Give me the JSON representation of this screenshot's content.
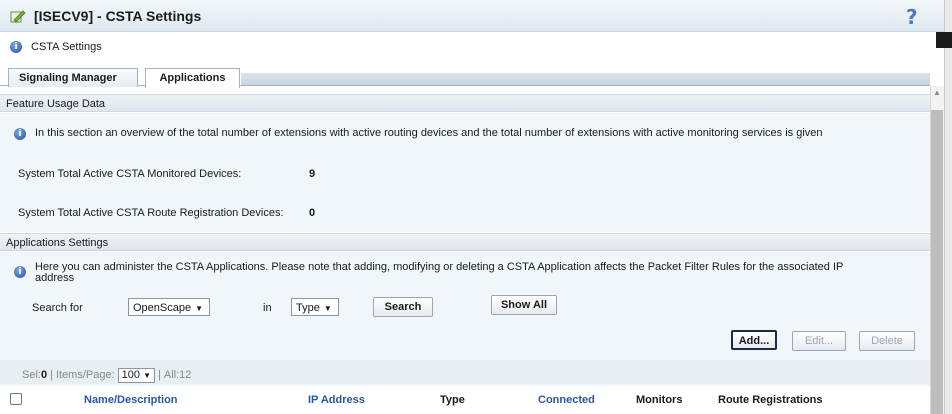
{
  "window": {
    "title": "[ISECV9] - CSTA Settings",
    "help_glyph": "?"
  },
  "breadcrumb": {
    "label": "CSTA Settings",
    "icon": "info-icon"
  },
  "tabs": [
    {
      "label": "Signaling Manager",
      "active": false
    },
    {
      "label": "Applications",
      "active": true
    }
  ],
  "feature_usage": {
    "header": "Feature Usage Data",
    "note": "In this section an overview of the total number of extensions with active routing devices and the total number of extensions with active monitoring services is given",
    "monitored_label": "System Total Active CSTA Monitored Devices:",
    "monitored_value": "9",
    "route_label": "System Total Active CSTA Route Registration Devices:",
    "route_value": "0"
  },
  "applications": {
    "header": "Applications Settings",
    "note_line1": "Here you can administer the CSTA Applications. Please note that adding, modifying or deleting a CSTA Application affects the Packet Filter Rules for the associated IP",
    "note_line2": "address",
    "search_for_label": "Search for",
    "search_value": "OpenScape",
    "in_label": "in",
    "field_value": "Type",
    "search_button": "Search",
    "show_all_button": "Show All",
    "add_button": "Add...",
    "edit_button": "Edit...",
    "delete_button": "Delete"
  },
  "pager": {
    "sel_label": "Sel:",
    "sel_value": "0",
    "items_label": "Items/Page:",
    "items_value": "100",
    "all_label": "All:",
    "all_value": "12"
  },
  "table": {
    "columns": [
      "Name/Description",
      "IP Address",
      "Type",
      "Connected",
      "Monitors",
      "Route Registrations"
    ]
  },
  "colors": {
    "accent": "#2b56a6",
    "panel": "#f1f6fb",
    "titlebar": "#dfe8f1"
  }
}
